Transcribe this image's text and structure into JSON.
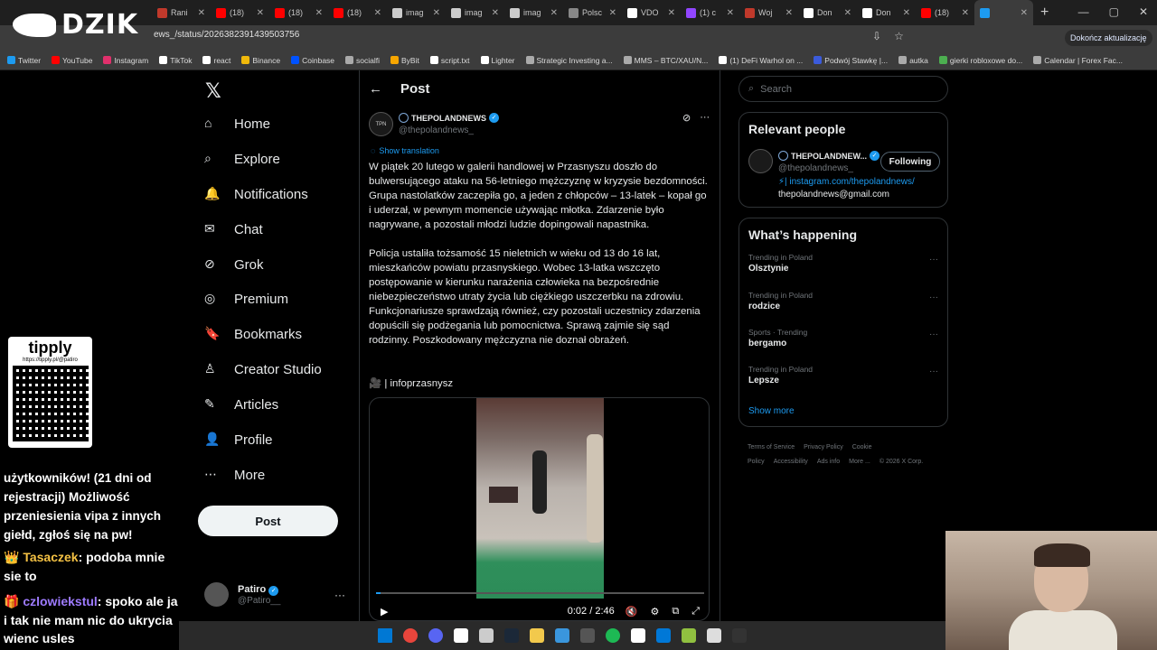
{
  "browser": {
    "tabs": [
      {
        "label": "Rani",
        "color": "#c0392b"
      },
      {
        "label": "(18)",
        "color": "#ff0000"
      },
      {
        "label": "(18)",
        "color": "#ff0000"
      },
      {
        "label": "(18)",
        "color": "#ff0000"
      },
      {
        "label": "imag",
        "color": "#cccccc"
      },
      {
        "label": "imag",
        "color": "#cccccc"
      },
      {
        "label": "imag",
        "color": "#cccccc"
      },
      {
        "label": "Polsc",
        "color": "#888888"
      },
      {
        "label": "VDO",
        "color": "#ffffff"
      },
      {
        "label": "(1) c",
        "color": "#9146ff"
      },
      {
        "label": "Woj",
        "color": "#c0392b"
      },
      {
        "label": "Don",
        "color": "#ffffff"
      },
      {
        "label": "Don",
        "color": "#ffffff"
      },
      {
        "label": "(18)",
        "color": "#ff0000"
      },
      {
        "label": "",
        "color": "#1d9bf0"
      }
    ],
    "url": "ews_/status/2026382391439503756",
    "update_button": "Dokończ aktualizację",
    "bookmarks": [
      {
        "label": "Twitter",
        "color": "#1d9bf0"
      },
      {
        "label": "YouTube",
        "color": "#ff0000"
      },
      {
        "label": "Instagram",
        "color": "#e1306c"
      },
      {
        "label": "TikTok",
        "color": "#ffffff"
      },
      {
        "label": "react",
        "color": "#ffffff"
      },
      {
        "label": "Binance",
        "color": "#f0b90b"
      },
      {
        "label": "Coinbase",
        "color": "#0052ff"
      },
      {
        "label": "socialfi",
        "color": "#aaaaaa"
      },
      {
        "label": "ByBit",
        "color": "#f7a600"
      },
      {
        "label": "script.txt",
        "color": "#ffffff"
      },
      {
        "label": "Lighter",
        "color": "#ffffff"
      },
      {
        "label": "Strategic Investing a...",
        "color": "#aaaaaa"
      },
      {
        "label": "MMS – BTC/XAU/N...",
        "color": "#aaaaaa"
      },
      {
        "label": "(1) DeFi Warhol on ...",
        "color": "#ffffff"
      },
      {
        "label": "Podwój Stawkę |...",
        "color": "#3b5bdb"
      },
      {
        "label": "autka",
        "color": "#aaaaaa"
      },
      {
        "label": "gierki robloxowe do...",
        "color": "#4caf50"
      },
      {
        "label": "Calendar | Forex Fac...",
        "color": "#aaaaaa"
      }
    ]
  },
  "overlay": {
    "logo": "DZIK",
    "tipply_title": "tipply",
    "tipply_url": "https://tipply.pl/@patiro",
    "chat": [
      {
        "nick": "",
        "text": "użytkowników! (21 dni od rejestracji) Możliwość przeniesienia vipa z innych giełd, zgłoś się na pw!"
      },
      {
        "nick": "Tasaczek",
        "text": ": podoba mnie sie to"
      },
      {
        "nick": "czlowiekstul",
        "text": ": spoko ale ja i tak nie mam nic do ukrycia"
      },
      {
        "nick": "",
        "text": "wienc usles"
      }
    ]
  },
  "nav": {
    "items": [
      "Home",
      "Explore",
      "Notifications",
      "Chat",
      "Grok",
      "Premium",
      "Bookmarks",
      "Creator Studio",
      "Articles",
      "Profile",
      "More"
    ],
    "post_button": "Post",
    "account_name": "Patiro",
    "account_handle": "@Patiro__"
  },
  "post": {
    "header_title": "Post",
    "author_name": "THEPOLANDNEWS",
    "author_handle": "@thepolandnews_",
    "show_translation": "Show translation",
    "paragraph1": "W piątek 20 lutego w galerii handlowej w Przasnyszu doszło do bulwersującego ataku na 56-letniego mężczyznę w kryzysie bezdomności. Grupa nastolatków zaczepiła go, a jeden z chłopców – 13-latek – kopał go i uderzał, w pewnym momencie używając młotka. Zdarzenie było nagrywane, a pozostali młodzi ludzie dopingowali napastnika.",
    "paragraph2": "Policja ustaliła tożsamość 15 nieletnich w wieku od 13 do 16 lat, mieszkańców powiatu przasnyskiego. Wobec 13-latka wszczęto postępowanie w kierunku narażenia człowieka na bezpośrednie niebezpieczeństwo utraty życia lub ciężkiego uszczerbku na zdrowiu. Funkcjonariusze sprawdzają również, czy pozostali uczestnicy zdarzenia dopuścili się podżegania lub pomocnictwa. Sprawą zajmie się sąd rodzinny. Poszkodowany mężczyzna nie doznał obrażeń.",
    "credit": "🎥 | infoprzasnysz",
    "video_time": "0:02 / 2:46",
    "video_progress": 0.013
  },
  "sidebar": {
    "search_placeholder": "Search",
    "relevant_title": "Relevant people",
    "rp_name": "THEPOLANDNEW...",
    "rp_handle": "@thepolandnews_",
    "follow_label": "Following",
    "rp_bio_link": "⚡| instagram.com/thepolandnews/",
    "rp_bio_email": "thepolandnews@gmail.com",
    "happening_title": "What’s happening",
    "trends": [
      {
        "context": "Trending in Poland",
        "name": "Olsztynie"
      },
      {
        "context": "Trending in Poland",
        "name": "rodzice"
      },
      {
        "context": "Sports · Trending",
        "name": "bergamo"
      },
      {
        "context": "Trending in Poland",
        "name": "Lepsze"
      }
    ],
    "show_more": "Show more",
    "footer": [
      "Terms of Service",
      "Privacy Policy",
      "Cookie Policy",
      "Accessibility",
      "Ads info",
      "More ...",
      "© 2026 X Corp."
    ]
  },
  "taskbar": {
    "icons": [
      "windows-icon",
      "chrome-icon",
      "discord-icon",
      "app-icon",
      "obs-icon",
      "steam-icon",
      "folder-icon",
      "settings-icon",
      "app2-icon",
      "spotify-icon",
      "app3-icon",
      "vscode-icon",
      "app4-icon",
      "notepad-icon",
      "app5-icon"
    ],
    "colors": [
      "#0078d4",
      "#e8453c",
      "#5865f2",
      "#ffffff",
      "#cccccc",
      "#1b2838",
      "#f2c94c",
      "#3a96dd",
      "#555555",
      "#1db954",
      "#ffffff",
      "#0078d7",
      "#90c040",
      "#dddddd",
      "#333333"
    ]
  },
  "colors": {
    "accent": "#1d9bf0",
    "bg": "#000000",
    "border": "#2f3336",
    "muted": "#71767b"
  }
}
